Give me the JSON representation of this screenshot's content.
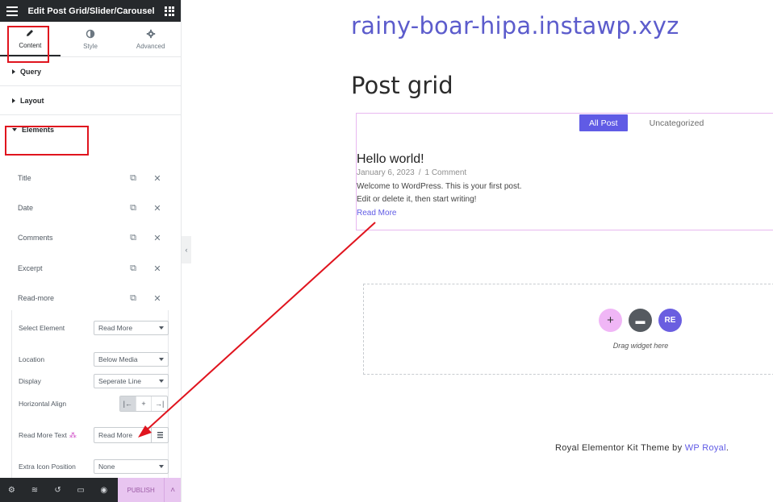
{
  "editor": {
    "title": "Edit Post Grid/Slider/Carousel",
    "tabs": [
      {
        "label": "Content",
        "icon": "pencil-icon"
      },
      {
        "label": "Style",
        "icon": "contrast-icon"
      },
      {
        "label": "Advanced",
        "icon": "gear-icon"
      }
    ],
    "sections": {
      "query": "Query",
      "layout": "Layout",
      "elements": "Elements"
    },
    "repeater_items": [
      "Title",
      "Date",
      "Comments",
      "Excerpt",
      "Read-more"
    ],
    "controls": {
      "select_element": {
        "label": "Select Element",
        "value": "Read More"
      },
      "location": {
        "label": "Location",
        "value": "Below Media"
      },
      "display": {
        "label": "Display",
        "value": "Seperate Line"
      },
      "horizontal_align": {
        "label": "Horizontal Align",
        "selected": "left"
      },
      "read_more_text": {
        "label": "Read More Text",
        "value": "Read More"
      },
      "extra_icon_position": {
        "label": "Extra Icon Position",
        "value": "None"
      }
    },
    "footer": {
      "publish": "PUBLISH"
    }
  },
  "preview": {
    "site_title": "rainy-boar-hipa.instawp.xyz",
    "page_title": "Post grid",
    "filters": [
      "All Post",
      "Uncategorized"
    ],
    "post": {
      "title": "Hello world!",
      "date": "January 6, 2023",
      "separator": "/",
      "comments": "1 Comment",
      "excerpt_line1": "Welcome to WordPress. This is your first post.",
      "excerpt_line2": "Edit or delete it, then start writing!",
      "read_more": "Read More"
    },
    "drop_zone": {
      "hint": "Drag widget here",
      "re_label": "RE"
    },
    "credit": {
      "text": "Royal Elementor Kit Theme by ",
      "link": "WP Royal",
      "suffix": "."
    }
  },
  "colors": {
    "accent": "#605be5",
    "highlight": "#e0141e",
    "publish_bg": "#e8c5f0"
  }
}
